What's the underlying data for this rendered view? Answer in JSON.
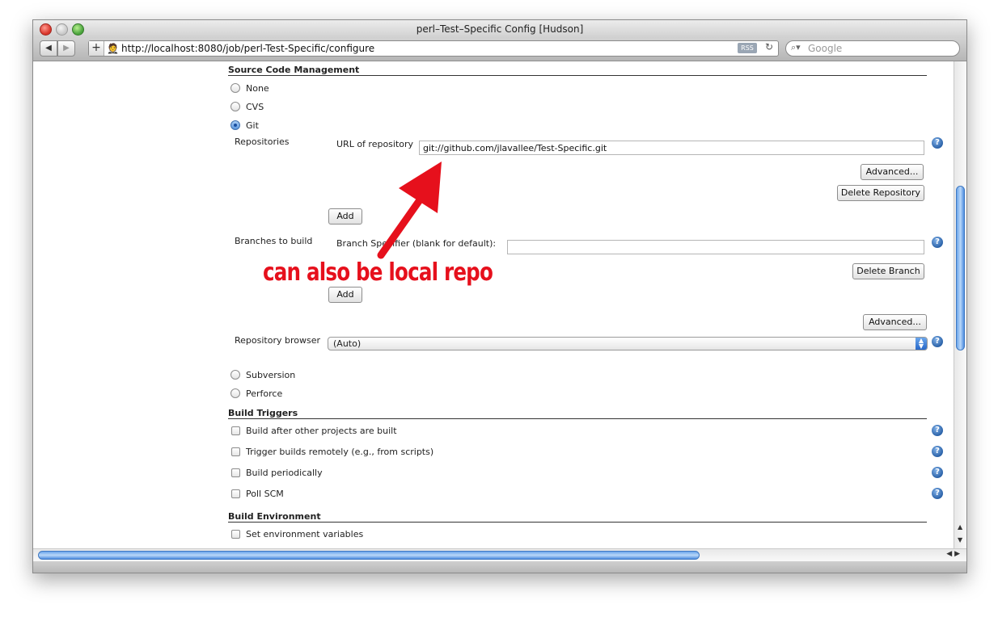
{
  "window": {
    "title": "perl–Test–Specific Config [Hudson]"
  },
  "toolbar": {
    "back": "◀",
    "forward": "▶",
    "plus": "+",
    "url": "http://localhost:8080/job/perl-Test-Specific/configure",
    "rss": "RSS",
    "reload": "↻",
    "search_placeholder": "Google",
    "search_icon": "magnifier-icon"
  },
  "scm": {
    "title": "Source Code Management",
    "options": {
      "none": "None",
      "cvs": "CVS",
      "git": "Git",
      "subversion": "Subversion",
      "perforce": "Perforce"
    },
    "selected": "Git",
    "repositories_label": "Repositories",
    "url_label": "URL of repository",
    "url_value": "git://github.com/jlavallee/Test-Specific.git",
    "advanced_label": "Advanced...",
    "delete_repo_label": "Delete Repository",
    "add_label": "Add",
    "branches_label": "Branches to build",
    "branch_spec_label": "Branch Specifier (blank for default):",
    "branch_spec_value": "",
    "delete_branch_label": "Delete Branch",
    "add_branch_label": "Add",
    "advanced2_label": "Advanced...",
    "repo_browser_label": "Repository browser",
    "repo_browser_value": "(Auto)"
  },
  "triggers": {
    "title": "Build Triggers",
    "items": [
      "Build after other projects are built",
      "Trigger builds remotely (e.g., from scripts)",
      "Build periodically",
      "Poll SCM"
    ]
  },
  "environment": {
    "title": "Build Environment",
    "items": [
      "Set environment variables"
    ]
  },
  "annotation": {
    "text": "can also be local repo",
    "color": "#e6101c"
  },
  "help_glyph": "?"
}
